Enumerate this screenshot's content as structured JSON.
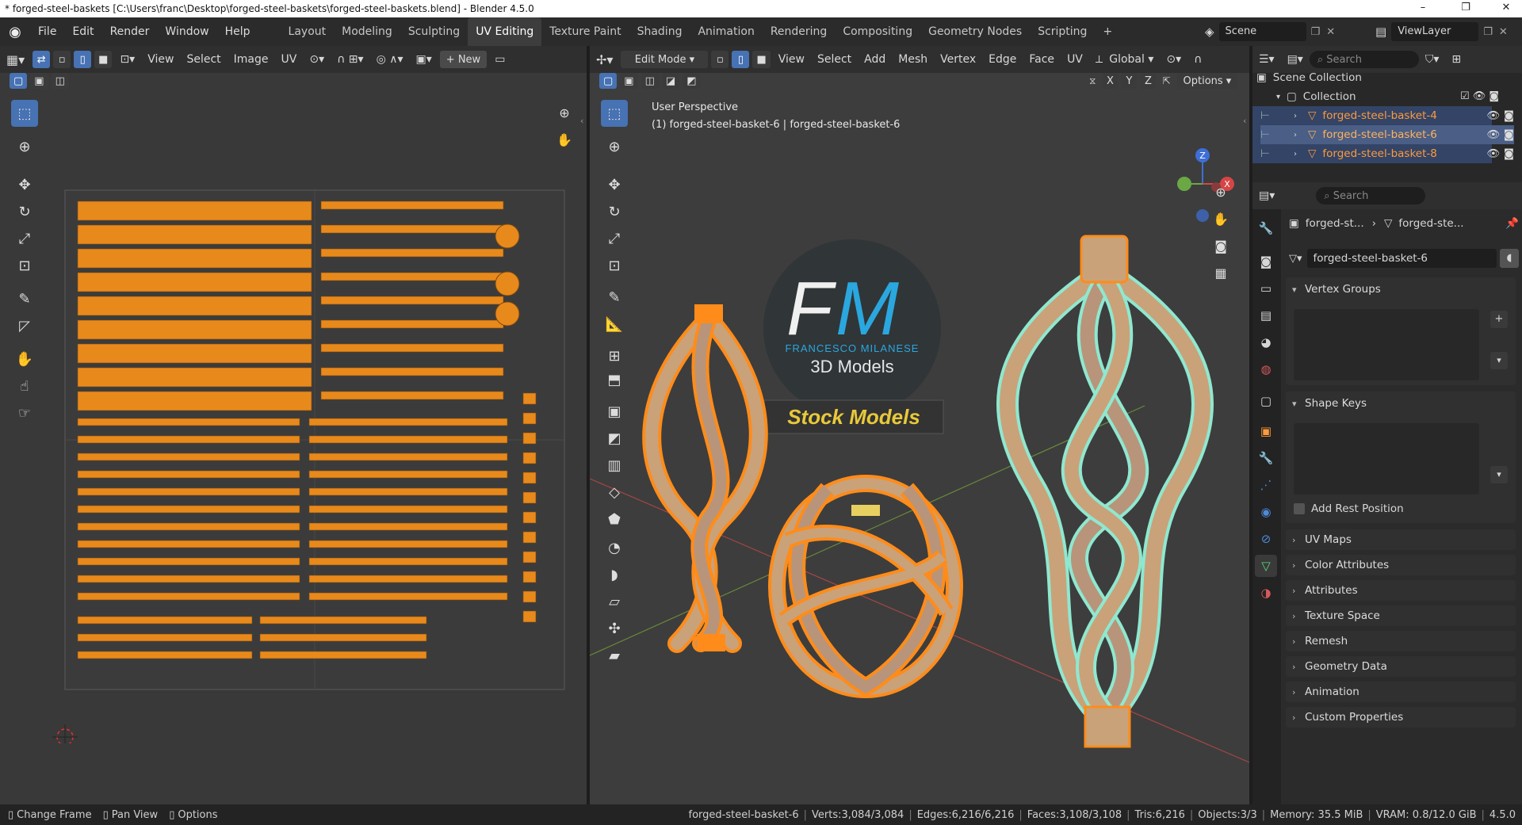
{
  "window": {
    "title": "* forged-steel-baskets [C:\\Users\\franc\\Desktop\\forged-steel-baskets\\forged-steel-baskets.blend] - Blender 4.5.0",
    "controls": [
      "–",
      "❐",
      "✕"
    ]
  },
  "menu": [
    "File",
    "Edit",
    "Render",
    "Window",
    "Help"
  ],
  "workspaces": [
    "Layout",
    "Modeling",
    "Sculpting",
    "UV Editing",
    "Texture Paint",
    "Shading",
    "Animation",
    "Rendering",
    "Compositing",
    "Geometry Nodes",
    "Scripting"
  ],
  "active_workspace": "UV Editing",
  "scene": {
    "label": "Scene",
    "view_layer": "ViewLayer"
  },
  "uv_editor": {
    "menus": [
      "View",
      "Select",
      "Image",
      "UV"
    ],
    "new_label": "New"
  },
  "viewport": {
    "mode": "Edit Mode",
    "menus": [
      "View",
      "Select",
      "Add",
      "Mesh",
      "Vertex",
      "Edge",
      "Face",
      "UV"
    ],
    "transform": "Global",
    "options_label": "Options",
    "axes": [
      "X",
      "Y",
      "Z"
    ],
    "overlay_line1": "User Perspective",
    "overlay_line2": "(1) forged-steel-basket-6 | forged-steel-basket-6"
  },
  "watermark": {
    "letters_f": "F",
    "letters_m": "M",
    "name": "FRANCESCO MILANESE",
    "sub": "3D Models",
    "banner": "Stock Models"
  },
  "outliner": {
    "search_placeholder": "Search",
    "root": "Scene Collection",
    "collection": "Collection",
    "items": [
      "forged-steel-basket-4",
      "forged-steel-basket-6",
      "forged-steel-basket-8"
    ]
  },
  "properties": {
    "search_placeholder": "Search",
    "breadcrumb_obj": "forged-st...",
    "breadcrumb_data": "forged-ste...",
    "mesh_name": "forged-steel-basket-6",
    "vertex_groups": "Vertex Groups",
    "shape_keys": "Shape Keys",
    "add_rest_position": "Add Rest Position",
    "sections": [
      "UV Maps",
      "Color Attributes",
      "Attributes",
      "Texture Space",
      "Remesh",
      "Geometry Data",
      "Animation",
      "Custom Properties"
    ]
  },
  "status": {
    "left": [
      "Change Frame",
      "Pan View",
      "Options"
    ],
    "object": "forged-steel-basket-6",
    "verts": "Verts:3,084/3,084",
    "edges": "Edges:6,216/6,216",
    "faces": "Faces:3,108/3,108",
    "tris": "Tris:6,216",
    "objects": "Objects:3/3",
    "memory": "Memory: 35.5 MiB",
    "vram": "VRAM: 0.8/12.0 GiB",
    "version": "4.5.0"
  },
  "colors": {
    "accent": "#4772b3",
    "uv_island": "#e8891c",
    "selection": "#ff8c1a",
    "active_mesh": "#8fe8d0",
    "watermark_blue": "#2aa7de",
    "banner_text": "#e8c93a"
  }
}
